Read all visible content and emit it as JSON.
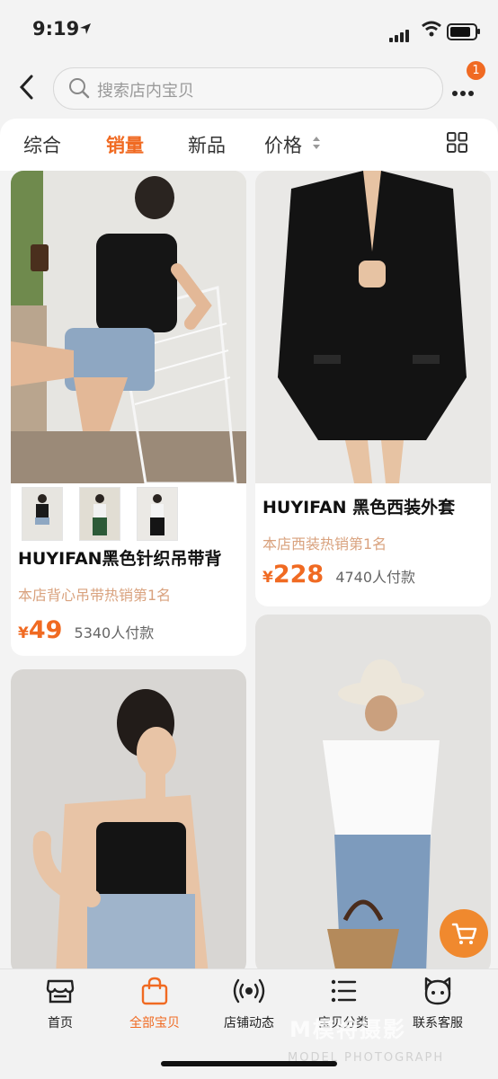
{
  "status_bar": {
    "time": "9:19"
  },
  "search": {
    "placeholder": "搜索店内宝贝"
  },
  "header": {
    "notification_count": "1"
  },
  "sort_tabs": [
    {
      "label": "综合"
    },
    {
      "label": "销量",
      "active": true
    },
    {
      "label": "新品"
    },
    {
      "label": "价格"
    }
  ],
  "products": [
    {
      "title": "HUYIFAN黑色针织吊带背",
      "rank": "本店背心吊带热销第1名",
      "currency": "¥",
      "price": "49",
      "sold": "5340人付款"
    },
    {
      "title": "HUYIFAN 黑色西装外套",
      "rank": "本店西装热销第1名",
      "currency": "¥",
      "price": "228",
      "sold": "4740人付款"
    }
  ],
  "bottom_nav": [
    {
      "label": "首页",
      "icon": "store-icon"
    },
    {
      "label": "全部宝贝",
      "icon": "bag-icon",
      "active": true
    },
    {
      "label": "店铺动态",
      "icon": "broadcast-icon"
    },
    {
      "label": "宝贝分类",
      "icon": "list-icon"
    },
    {
      "label": "联系客服",
      "icon": "service-face-icon"
    }
  ],
  "watermark": {
    "main": "M模特摄影",
    "sub": "MODEL PHOTOGRAPH"
  },
  "colors": {
    "accent": "#f06a22",
    "rank_text": "#d9a27e",
    "cart_button": "#f0892e"
  }
}
